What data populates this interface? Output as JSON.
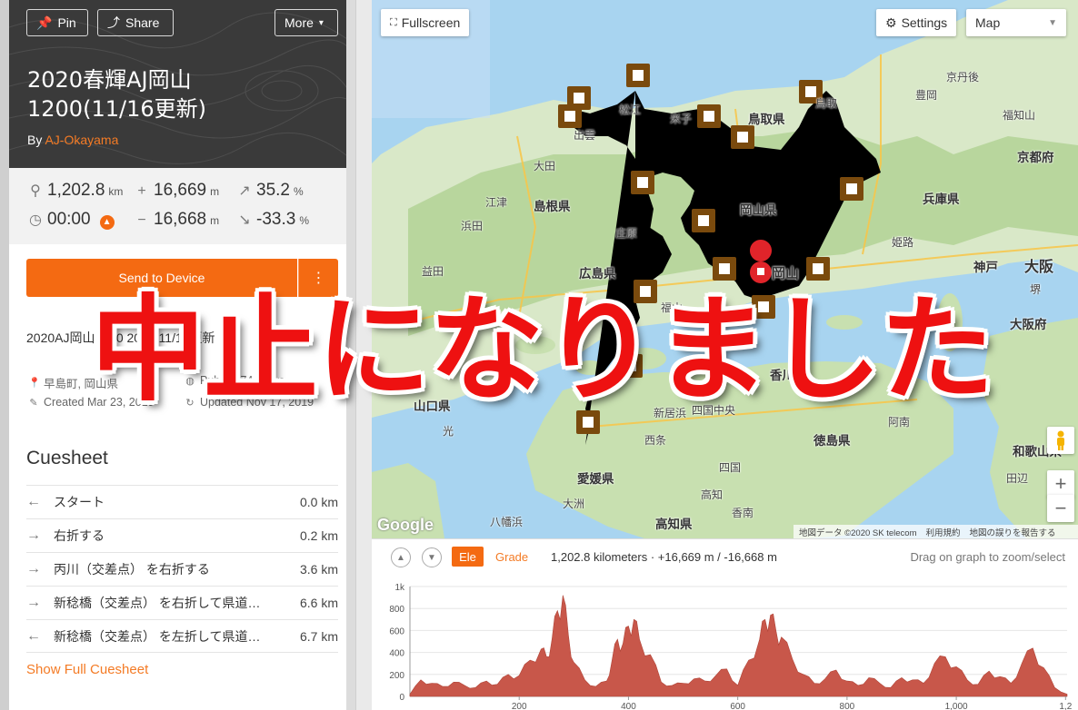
{
  "header": {
    "pin_label": "Pin",
    "share_label": "Share",
    "more_label": "More",
    "title_line1": "2020春輝AJ岡山",
    "title_line2": "1200(11/16更新)",
    "by_label": "By",
    "author": "AJ-Okayama"
  },
  "stats": {
    "distance": "1,202.8",
    "distance_unit": "km",
    "elevation_gain": "16,669",
    "elevation_gain_unit": "m",
    "max_grade": "35.2",
    "max_grade_unit": "%",
    "duration": "00:00",
    "elevation_loss": "16,668",
    "elevation_loss_unit": "m",
    "min_grade": "-33.3",
    "min_grade_unit": "%"
  },
  "actions": {
    "send_label": "Send to Device",
    "send_more_icon": "⋮"
  },
  "details": {
    "description": "2020AJ岡山1200 2019/11/16更新",
    "location": "早島町, 岡山県",
    "visibility": "Public 674 views",
    "created": "Created Mar 23, 2019",
    "updated": "Updated Nov 17, 2019"
  },
  "cuesheet": {
    "title": "Cuesheet",
    "show_full_label": "Show Full Cuesheet",
    "rows": [
      {
        "direction": "start",
        "arrow": "←",
        "text": "スタート",
        "dist": "0.0 km"
      },
      {
        "direction": "right",
        "arrow": "→",
        "text": "右折する",
        "dist": "0.2 km"
      },
      {
        "direction": "right",
        "arrow": "→",
        "text": "丙川（交差点） を右折する",
        "dist": "3.6 km"
      },
      {
        "direction": "right",
        "arrow": "→",
        "text": "新稔橋（交差点） を右折して県道…",
        "dist": "6.6 km"
      },
      {
        "direction": "left",
        "arrow": "←",
        "text": "新稔橋（交差点） を左折して県道…",
        "dist": "6.7 km"
      }
    ]
  },
  "map": {
    "fullscreen_label": "Fullscreen",
    "settings_label": "Settings",
    "type_selected": "Map",
    "google_label": "Google",
    "attribution": [
      "地図データ ©2020 SK telecom",
      "利用規約",
      "地図の誤りを報告する"
    ],
    "labels": [
      {
        "text": "京丹後",
        "kind": "small"
      },
      {
        "text": "豊岡",
        "kind": "small"
      },
      {
        "text": "鳥取県",
        "kind": "big"
      },
      {
        "text": "鳥取",
        "kind": "big"
      },
      {
        "text": "米子",
        "kind": "small"
      },
      {
        "text": "松江",
        "kind": "small"
      },
      {
        "text": "出雲",
        "kind": "small"
      },
      {
        "text": "大田",
        "kind": "small"
      },
      {
        "text": "島根県",
        "kind": "big"
      },
      {
        "text": "江津",
        "kind": "small"
      },
      {
        "text": "浜田",
        "kind": "small"
      },
      {
        "text": "益田",
        "kind": "small"
      },
      {
        "text": "庄原",
        "kind": "small"
      },
      {
        "text": "岡山県",
        "kind": "big"
      },
      {
        "text": "京都府",
        "kind": "big"
      },
      {
        "text": "兵庫県",
        "kind": "big"
      },
      {
        "text": "福知山",
        "kind": "small"
      },
      {
        "text": "姫路",
        "kind": "small"
      },
      {
        "text": "神戸",
        "kind": "big"
      },
      {
        "text": "大阪",
        "kind": "big"
      },
      {
        "text": "堺",
        "kind": "small"
      },
      {
        "text": "大阪府",
        "kind": "big"
      },
      {
        "text": "広島県",
        "kind": "big"
      },
      {
        "text": "福山",
        "kind": "small"
      },
      {
        "text": "岡山",
        "kind": "big"
      },
      {
        "text": "山口県",
        "kind": "big"
      },
      {
        "text": "光",
        "kind": "small"
      },
      {
        "text": "香川県",
        "kind": "big"
      },
      {
        "text": "新居浜",
        "kind": "small"
      },
      {
        "text": "四国中央",
        "kind": "small"
      },
      {
        "text": "西条",
        "kind": "small"
      },
      {
        "text": "徳島県",
        "kind": "big"
      },
      {
        "text": "阿南",
        "kind": "small"
      },
      {
        "text": "和歌山県",
        "kind": "big"
      },
      {
        "text": "田辺",
        "kind": "small"
      },
      {
        "text": "愛媛県",
        "kind": "big"
      },
      {
        "text": "大洲",
        "kind": "small"
      },
      {
        "text": "八幡浜",
        "kind": "small"
      },
      {
        "text": "高知",
        "kind": "small"
      },
      {
        "text": "香南",
        "kind": "small"
      },
      {
        "text": "高知県",
        "kind": "big"
      },
      {
        "text": "四国",
        "kind": "small"
      }
    ]
  },
  "elevation": {
    "ele_label": "Ele",
    "grade_label": "Grade",
    "summary": "1,202.8 kilometers · +16,669 m / -16,668 m",
    "hint": "Drag on graph to zoom/select",
    "y_ticks": [
      "1k",
      "800",
      "600",
      "400",
      "200",
      "0"
    ],
    "x_ticks": [
      "200",
      "400",
      "600",
      "800",
      "1,000",
      "1,2"
    ]
  },
  "overlay": {
    "text": "中止になりました"
  },
  "colors": {
    "accent": "#f46a12",
    "route": "#e0242a",
    "elevation_fill": "#c8574a"
  },
  "chart_data": {
    "type": "area",
    "xlabel": "",
    "ylabel": "",
    "xlim": [
      0,
      1202.8
    ],
    "ylim": [
      0,
      1000
    ],
    "x": [
      0,
      20,
      40,
      60,
      80,
      100,
      120,
      140,
      160,
      180,
      200,
      220,
      240,
      250,
      260,
      270,
      280,
      290,
      300,
      320,
      340,
      360,
      370,
      380,
      390,
      400,
      410,
      420,
      440,
      460,
      480,
      500,
      520,
      540,
      560,
      580,
      600,
      620,
      640,
      650,
      660,
      670,
      680,
      700,
      720,
      740,
      760,
      780,
      800,
      820,
      840,
      860,
      880,
      900,
      920,
      940,
      960,
      980,
      1000,
      1020,
      1040,
      1060,
      1080,
      1100,
      1120,
      1140,
      1160,
      1180,
      1202.8
    ],
    "values": [
      20,
      150,
      120,
      90,
      130,
      100,
      80,
      140,
      110,
      200,
      190,
      330,
      430,
      360,
      520,
      780,
      920,
      560,
      310,
      150,
      90,
      140,
      330,
      520,
      480,
      640,
      700,
      520,
      380,
      130,
      100,
      120,
      160,
      140,
      190,
      250,
      100,
      330,
      520,
      700,
      740,
      600,
      540,
      340,
      200,
      120,
      160,
      240,
      140,
      100,
      170,
      120,
      80,
      170,
      150,
      120,
      300,
      360,
      270,
      150,
      110,
      230,
      180,
      120,
      300,
      440,
      260,
      80,
      20
    ]
  }
}
